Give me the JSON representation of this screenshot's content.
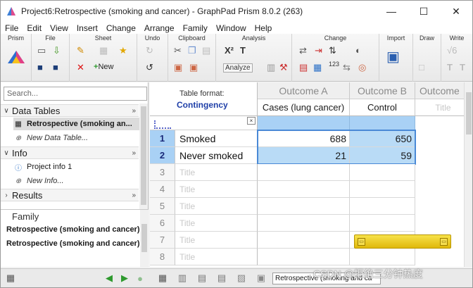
{
  "window": {
    "title": "Project6:Retrospective (smoking and cancer) - GraphPad Prism 8.0.2 (263)",
    "minimize": "—",
    "maximize": "☐",
    "close": "✕"
  },
  "menu": [
    "File",
    "Edit",
    "View",
    "Insert",
    "Change",
    "Arrange",
    "Family",
    "Window",
    "Help"
  ],
  "ribbon": {
    "groups": [
      "Prism",
      "File",
      "Sheet",
      "Undo",
      "Clipboard",
      "Analysis",
      "Change",
      "Import",
      "Draw",
      "Write"
    ],
    "new_label": "New",
    "analyze_label": "Analyze"
  },
  "nav": {
    "search_placeholder": "Search...",
    "sections": {
      "data_tables": "Data Tables",
      "info": "Info",
      "results": "Results"
    },
    "data_items": [
      "Retrospective (smoking an...",
      "New Data Table..."
    ],
    "info_items": [
      "Project info 1",
      "New Info..."
    ],
    "family": {
      "header": "Family",
      "items": [
        "Retrospective (smoking and cancer)",
        "Retrospective (smoking and cancer)"
      ]
    }
  },
  "sheet": {
    "table_format_label": "Table format:",
    "table_format_value": "Contingency",
    "columns": [
      {
        "header": "Outcome A",
        "title": "Cases (lung cancer)"
      },
      {
        "header": "Outcome B",
        "title": "Control"
      },
      {
        "header": "Outcome",
        "title": "Title"
      }
    ],
    "row_close": "×",
    "rows": [
      {
        "num": "1",
        "name": "Smoked",
        "a": "688",
        "b": "650"
      },
      {
        "num": "2",
        "name": "Never smoked",
        "a": "21",
        "b": "59"
      },
      {
        "num": "3",
        "name": "Title"
      },
      {
        "num": "4",
        "name": "Title"
      },
      {
        "num": "5",
        "name": "Title"
      },
      {
        "num": "6",
        "name": "Title"
      },
      {
        "num": "7",
        "name": "Title"
      },
      {
        "num": "8",
        "name": "Title"
      }
    ]
  },
  "statusbar": {
    "sheet_selector": "Retrospective (smoking and ca",
    "watermark": "CSDN @拒绝三分钟热度"
  },
  "colors": {
    "selection_blue": "#a9d1f5",
    "selected_cell": "#b9dbf6",
    "contingency_text": "#1f3fa8",
    "floating_toolbar": "#f0cf2a"
  }
}
